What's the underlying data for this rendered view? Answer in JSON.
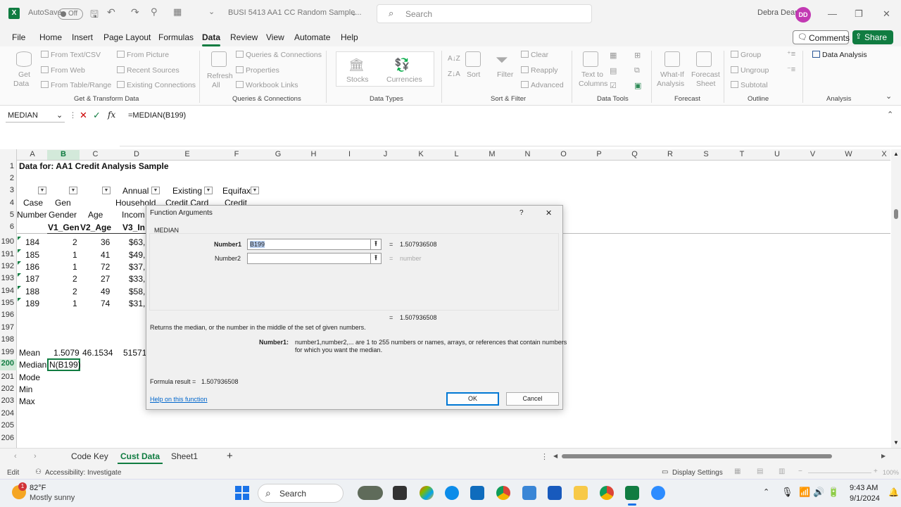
{
  "titlebar": {
    "autosave_label": "AutoSave",
    "autosave_state": "Off",
    "filename": "BUSI 5413 AA1 CC Random Sample...",
    "search_placeholder": "Search",
    "user_name": "Debra Dean",
    "user_initials": "DD"
  },
  "menu": {
    "tabs": [
      "File",
      "Home",
      "Insert",
      "Page Layout",
      "Formulas",
      "Data",
      "Review",
      "View",
      "Automate",
      "Help"
    ],
    "active": "Data",
    "comments_label": "Comments",
    "share_label": "Share"
  },
  "ribbon": {
    "get_data": "Get",
    "get_data2": "Data",
    "from_text_csv": "From Text/CSV",
    "from_web": "From Web",
    "from_table_range": "From Table/Range",
    "from_picture": "From Picture",
    "recent_sources": "Recent Sources",
    "existing_connections": "Existing Connections",
    "group_get_transform": "Get & Transform Data",
    "refresh": "Refresh",
    "refresh_all": "All",
    "queries_connections": "Queries & Connections",
    "properties": "Properties",
    "workbook_links": "Workbook Links",
    "group_queries": "Queries & Connections",
    "stocks": "Stocks",
    "currencies": "Currencies",
    "group_data_types": "Data Types",
    "sort": "Sort",
    "filter": "Filter",
    "clear": "Clear",
    "reapply": "Reapply",
    "advanced": "Advanced",
    "group_sort_filter": "Sort & Filter",
    "text_to": "Text to",
    "columns": "Columns",
    "group_data_tools": "Data Tools",
    "what_if": "What-If",
    "analysis": "Analysis",
    "forecast": "Forecast",
    "sheet": "Sheet",
    "group_forecast": "Forecast",
    "group_btn": "Group",
    "ungroup": "Ungroup",
    "subtotal": "Subtotal",
    "group_outline": "Outline",
    "data_analysis": "Data Analysis",
    "group_analysis": "Analysis"
  },
  "formula_bar": {
    "name_box": "MEDIAN",
    "formula": "=MEDIAN(B199)"
  },
  "columns": [
    "A",
    "B",
    "C",
    "D",
    "E",
    "F",
    "G",
    "H",
    "I",
    "J",
    "K",
    "L",
    "M",
    "N",
    "O",
    "P",
    "Q",
    "R",
    "S",
    "T",
    "U",
    "V",
    "W",
    "X"
  ],
  "rows": [
    "1",
    "2",
    "3",
    "4",
    "5",
    "6",
    "190",
    "191",
    "192",
    "193",
    "194",
    "195",
    "196",
    "197",
    "198",
    "199",
    "200",
    "201",
    "202",
    "203",
    "204",
    "205",
    "206"
  ],
  "sheet": {
    "title": "Data for:  AA1 Credit Analysis Sample",
    "headers": {
      "a4": "Case",
      "b4": "Gen",
      "c5": "Age",
      "d3": "Annual",
      "d4": "Household",
      "d5": "Incom",
      "e3": "Existing",
      "e4": "Credit Card",
      "f3": "Equifax",
      "f4": "Credit",
      "a5": "Number",
      "b5": "Gender",
      "b6": "V1_Gen",
      "c6": "V2_Age",
      "d6": "V3_In"
    },
    "data_rows": [
      {
        "a": "184",
        "b": "2",
        "c": "36",
        "d": "$63,"
      },
      {
        "a": "185",
        "b": "1",
        "c": "41",
        "d": "$49,"
      },
      {
        "a": "186",
        "b": "1",
        "c": "72",
        "d": "$37,"
      },
      {
        "a": "187",
        "b": "2",
        "c": "27",
        "d": "$33,"
      },
      {
        "a": "188",
        "b": "2",
        "c": "49",
        "d": "$58,"
      },
      {
        "a": "189",
        "b": "1",
        "c": "74",
        "d": "$31,"
      }
    ],
    "stats": {
      "mean_label": "Mean",
      "mean_b": "1.5079",
      "mean_c": "46.1534",
      "mean_d": "51571.",
      "median_label": "Median",
      "median_b": "N(B199)",
      "mode_label": "Mode",
      "min_label": "Min",
      "max_label": "Max"
    }
  },
  "dialog": {
    "title": "Function Arguments",
    "help": "?",
    "close": "✕",
    "function_name": "MEDIAN",
    "number1_label": "Number1",
    "number1_value": "B199",
    "number1_result": "1.507936508",
    "number2_label": "Number2",
    "number2_placeholder": "number",
    "equals": "=",
    "overall_result": "1.507936508",
    "description": "Returns the median, or the number in the middle of the set of given numbers.",
    "arg_help_label": "Number1:",
    "arg_help_line1": "number1,number2,... are 1 to 255 numbers or names, arrays, or references that contain numbers",
    "arg_help_line2": "for which you want the median.",
    "formula_result_label": "Formula result =",
    "formula_result_value": "1.507936508",
    "help_link": "Help on this function",
    "ok": "OK",
    "cancel": "Cancel"
  },
  "sheets": {
    "tabs": [
      "Code Key",
      "Cust Data",
      "Sheet1"
    ],
    "active": "Cust Data",
    "add": "+"
  },
  "status": {
    "mode": "Edit",
    "accessibility": "Accessibility: Investigate",
    "display_settings": "Display Settings",
    "zoom": "100%"
  },
  "taskbar": {
    "weather_temp": "82°F",
    "weather_desc": "Mostly sunny",
    "weather_badge": "1",
    "search": "Search",
    "time": "9:43 AM",
    "date": "9/1/2024"
  },
  "colors": {
    "excel_green": "#107c41",
    "avatar": "#c239b3",
    "selection": "#d3e9da"
  }
}
